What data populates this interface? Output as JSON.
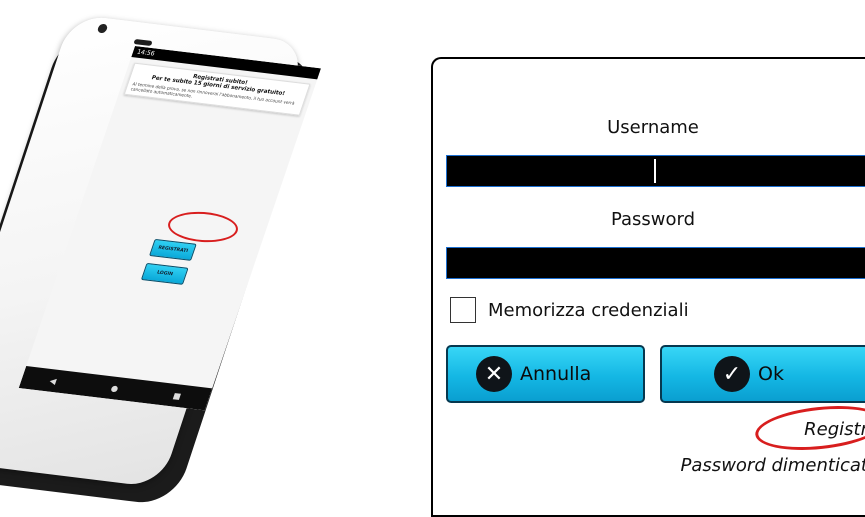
{
  "phone": {
    "status_time": "14:56",
    "card_title": "Registrati subito!",
    "card_subtitle": "Per te subito 15 giorni di servizio gratuito!",
    "card_body": "Al termine della prova, se non rinnoverai l'abbonamento, il tuo account verrà cancellato automaticamente.",
    "register_button": "REGISTRATI",
    "login_button": "LOGIN",
    "nav_back": "◀",
    "nav_home": "●",
    "nav_recent": "■"
  },
  "login": {
    "username_label": "Username",
    "password_label": "Password",
    "username_value": "",
    "password_value": "",
    "remember_label": "Memorizza credenziali",
    "remember_checked": false,
    "cancel_label": "Annulla",
    "ok_label": "Ok",
    "cancel_icon": "x-circle-icon",
    "ok_icon": "check-circle-icon",
    "register_link": "Registra",
    "forgot_link": "Password dimenticata"
  },
  "colors": {
    "button_accent": "#14b7e4",
    "highlight": "#d81e1e",
    "field_bg": "#000000"
  }
}
